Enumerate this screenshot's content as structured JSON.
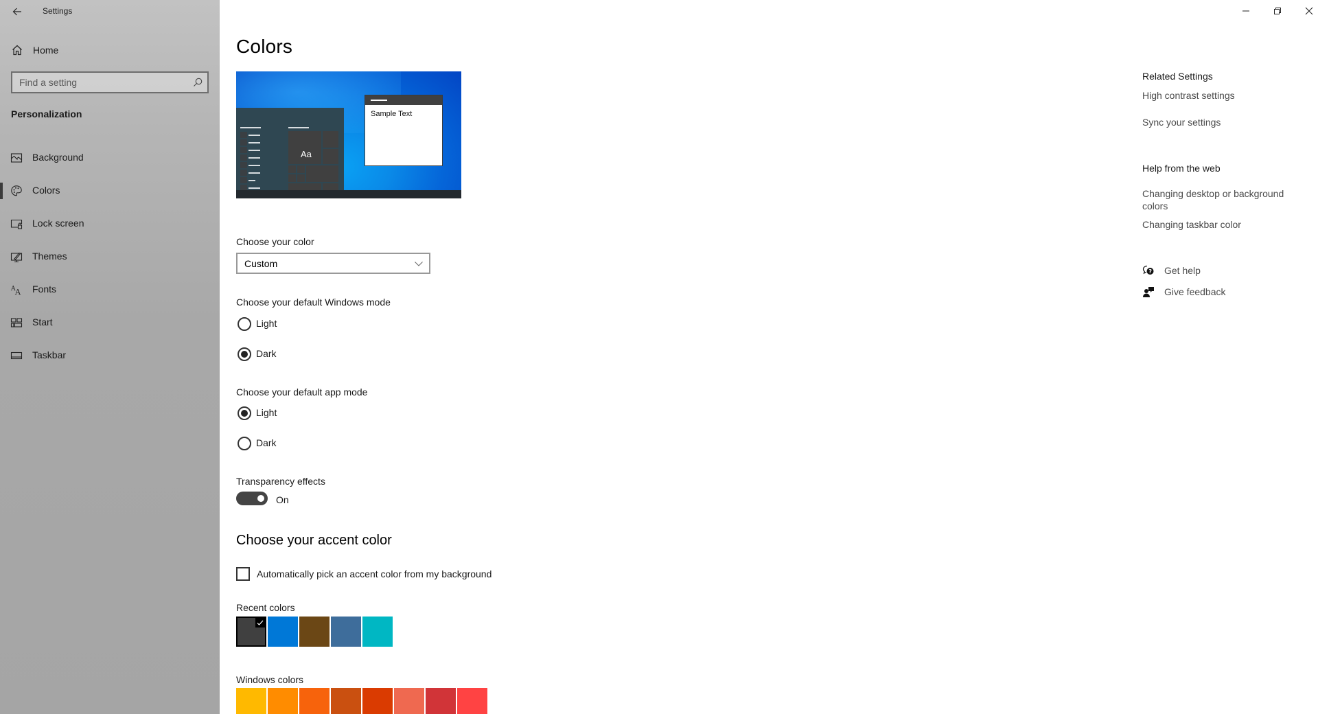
{
  "window": {
    "title": "Settings",
    "controls": {
      "minimize": "minimize-icon",
      "restore": "restore-icon",
      "close": "close-icon"
    }
  },
  "sidebar": {
    "back_icon": "arrow-left-icon",
    "home": {
      "label": "Home",
      "icon": "home-icon"
    },
    "search": {
      "placeholder": "Find a setting",
      "value": "",
      "icon": "search-icon"
    },
    "section_title": "Personalization",
    "items": [
      {
        "label": "Background",
        "icon": "picture-icon",
        "active": false
      },
      {
        "label": "Colors",
        "icon": "palette-icon",
        "active": true
      },
      {
        "label": "Lock screen",
        "icon": "lock-screen-icon",
        "active": false
      },
      {
        "label": "Themes",
        "icon": "themes-icon",
        "active": false
      },
      {
        "label": "Fonts",
        "icon": "fonts-icon",
        "active": false
      },
      {
        "label": "Start",
        "icon": "start-icon",
        "active": false
      },
      {
        "label": "Taskbar",
        "icon": "taskbar-icon",
        "active": false
      }
    ]
  },
  "main": {
    "title": "Colors",
    "preview": {
      "sample_text": "Sample Text",
      "tile_text": "Aa"
    },
    "choose_color": {
      "label": "Choose your color",
      "selected": "Custom"
    },
    "windows_mode": {
      "label": "Choose your default Windows mode",
      "options": [
        {
          "label": "Light",
          "selected": false
        },
        {
          "label": "Dark",
          "selected": true
        }
      ]
    },
    "app_mode": {
      "label": "Choose your default app mode",
      "options": [
        {
          "label": "Light",
          "selected": true
        },
        {
          "label": "Dark",
          "selected": false
        }
      ]
    },
    "transparency": {
      "label": "Transparency effects",
      "state": "On",
      "on": true
    },
    "accent": {
      "heading": "Choose your accent color",
      "auto_pick": {
        "label": "Automatically pick an accent color from my background",
        "checked": false
      },
      "recent_label": "Recent colors",
      "recent_colors": [
        {
          "color": "#404040",
          "selected": true
        },
        {
          "color": "#0078d7",
          "selected": false
        },
        {
          "color": "#6b4715",
          "selected": false
        },
        {
          "color": "#3e6d9b",
          "selected": false
        },
        {
          "color": "#00b7c3",
          "selected": false
        }
      ],
      "windows_label": "Windows colors",
      "windows_colors": [
        "#ffb900",
        "#ff8c00",
        "#f7630c",
        "#ca5010",
        "#da3b01",
        "#ef6950",
        "#d13438",
        "#ff4343"
      ]
    }
  },
  "right_panel": {
    "related_title": "Related Settings",
    "related_links": [
      "High contrast settings",
      "Sync your settings"
    ],
    "help_title": "Help from the web",
    "help_links": [
      "Changing desktop or background colors",
      "Changing taskbar color"
    ],
    "actions": [
      {
        "label": "Get help",
        "icon": "get-help-icon"
      },
      {
        "label": "Give feedback",
        "icon": "feedback-icon"
      }
    ]
  }
}
